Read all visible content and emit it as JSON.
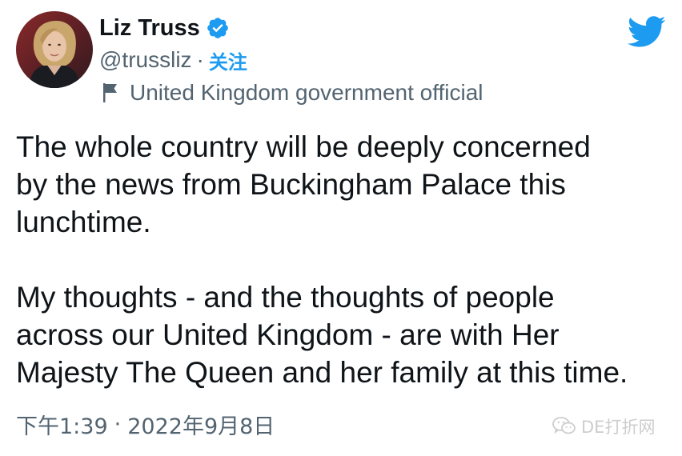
{
  "author": {
    "display_name": "Liz Truss",
    "handle": "@trussliz",
    "separator": "·",
    "follow_label": "关注",
    "account_label": "United Kingdom government official",
    "verified": true
  },
  "tweet": {
    "paragraph1_lines": [
      "The whole country will be deeply concerned",
      "by the news from Buckingham Palace this",
      "lunchtime."
    ],
    "paragraph2_lines": [
      "My thoughts - and the thoughts of people",
      "across our United Kingdom - are with Her",
      "Majesty The Queen and her family at this time."
    ]
  },
  "meta": {
    "time": "下午1:39",
    "separator": "·",
    "date": "2022年9月8日"
  },
  "watermark": {
    "text": "DE打折网",
    "icon": "wechat-icon"
  },
  "icons": {
    "verified": "verified-badge-icon",
    "label": "government-flag-icon",
    "logo": "twitter-bird-icon"
  },
  "colors": {
    "accent": "#1d9bf0",
    "text_primary": "#0f1419",
    "text_secondary": "#536471",
    "background": "#ffffff"
  }
}
